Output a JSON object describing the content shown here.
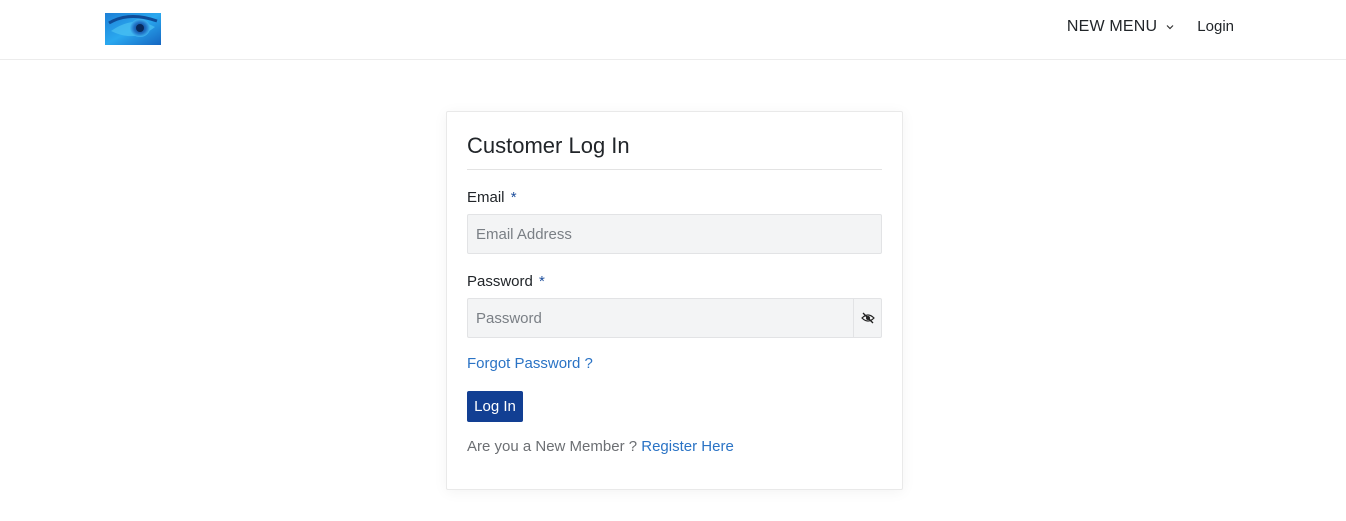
{
  "nav": {
    "logo_icon": "eye-logo",
    "menu_label": "NEW MENU",
    "menu_icon": "chevron-down-icon",
    "login_label": "Login"
  },
  "form": {
    "title": "Customer Log In",
    "email_label": "Email",
    "email_required": "*",
    "email_placeholder": "Email Address",
    "email_value": "",
    "password_label": "Password",
    "password_required": "*",
    "password_placeholder": "Password",
    "password_value": "",
    "toggle_icon": "eye-slash-icon",
    "forgot_label": "Forgot Password ?",
    "submit_label": "Log In",
    "register_prompt": "Are you a New Member ?",
    "register_label": "Register Here"
  },
  "colors": {
    "primary_button": "#123f93",
    "link": "#2a73c5",
    "required_marker": "#1d4e9c",
    "input_bg": "#f3f4f5"
  }
}
